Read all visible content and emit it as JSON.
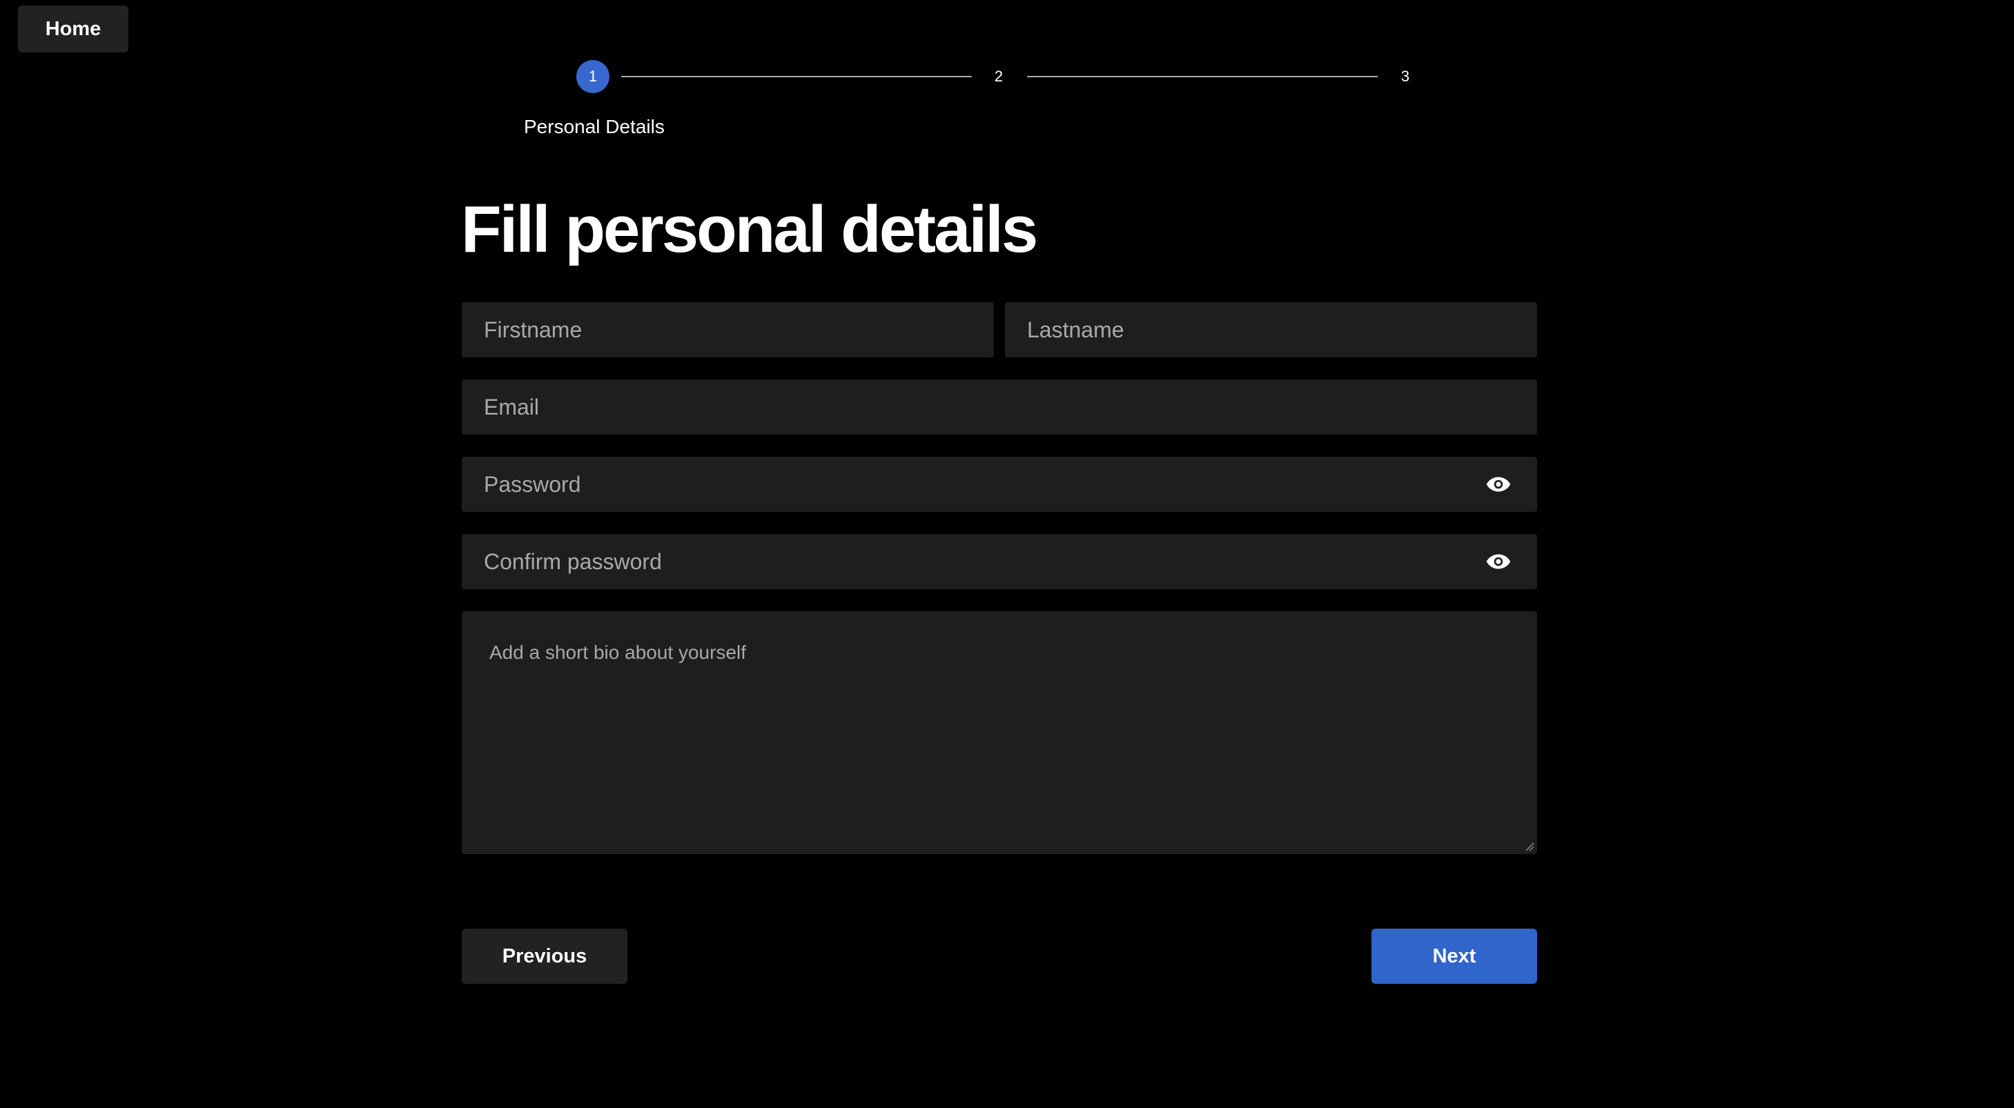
{
  "nav": {
    "home_label": "Home"
  },
  "stepper": {
    "steps": [
      {
        "number": "1",
        "active": true
      },
      {
        "number": "2",
        "active": false
      },
      {
        "number": "3",
        "active": false
      }
    ],
    "active_label": "Personal Details"
  },
  "form": {
    "title": "Fill personal details",
    "firstname_placeholder": "Firstname",
    "lastname_placeholder": "Lastname",
    "email_placeholder": "Email",
    "password_placeholder": "Password",
    "confirm_password_placeholder": "Confirm password",
    "bio_placeholder": "Add a short bio about yourself",
    "password_toggle_icon": "eye-icon",
    "confirm_password_toggle_icon": "eye-icon"
  },
  "actions": {
    "previous_label": "Previous",
    "next_label": "Next"
  },
  "colors": {
    "background": "#000000",
    "field_bg": "#1e1e1e",
    "accent": "#3065cb",
    "secondary_button": "#222222"
  }
}
